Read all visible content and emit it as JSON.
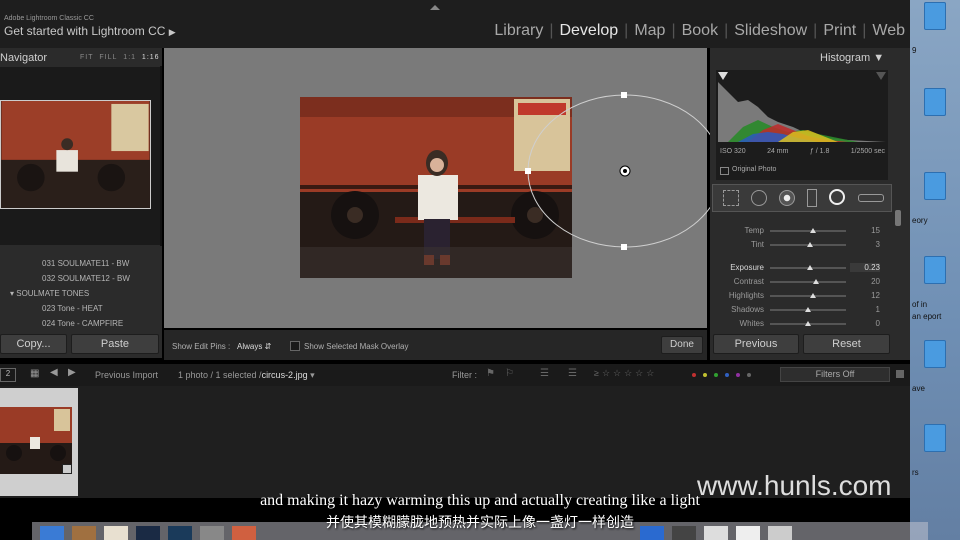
{
  "app": {
    "subtitle": "Adobe Lightroom Classic CC",
    "identity_plate": "Get started with Lightroom CC"
  },
  "modules": {
    "items": [
      "Library",
      "Develop",
      "Map",
      "Book",
      "Slideshow",
      "Print",
      "Web"
    ],
    "active": "Develop"
  },
  "navigator": {
    "title": "Navigator",
    "zoom": [
      "FIT",
      "FILL",
      "1:1",
      "1:16"
    ]
  },
  "presets": [
    {
      "label": "031 SOULMATE11 - BW",
      "type": "item"
    },
    {
      "label": "032 SOULMATE12 - BW",
      "type": "item"
    },
    {
      "label": "SOULMATE TONES",
      "type": "folder"
    },
    {
      "label": "023 Tone - HEAT",
      "type": "item"
    },
    {
      "label": "024 Tone - CAMPFIRE",
      "type": "item"
    }
  ],
  "left_buttons": {
    "copy": "Copy...",
    "paste": "Paste"
  },
  "toolbar": {
    "pins_label": "Show Edit Pins :",
    "pins_value": "Always",
    "mask_overlay": "Show Selected Mask Overlay",
    "done": "Done"
  },
  "histogram": {
    "title": "Histogram",
    "iso": "ISO 320",
    "focal": "24 mm",
    "aperture": "ƒ / 1.8",
    "shutter": "1/2500 sec",
    "original_photo": "Original Photo"
  },
  "sliders": [
    {
      "label": "Temp",
      "value": "15",
      "pos": 0.57
    },
    {
      "label": "Tint",
      "value": "3",
      "pos": 0.52
    },
    {
      "label": "Exposure",
      "value": "0.23",
      "pos": 0.53
    },
    {
      "label": "Contrast",
      "value": "20",
      "pos": 0.6
    },
    {
      "label": "Highlights",
      "value": "12",
      "pos": 0.56
    },
    {
      "label": "Shadows",
      "value": "1",
      "pos": 0.5
    },
    {
      "label": "Whites",
      "value": "0",
      "pos": 0.5
    }
  ],
  "right_buttons": {
    "previous": "Previous",
    "reset": "Reset"
  },
  "filmstrip": {
    "page": "2",
    "source": "Previous Import",
    "info_prefix": "1 photo / 1 selected /",
    "filename": "circus-2.jpg",
    "filter_label": "Filter :",
    "filters_off": "Filters Off"
  },
  "desktop_labels": [
    "9",
    "eory",
    "of in",
    "an eport",
    "ave",
    "rs"
  ],
  "subtitles": {
    "en": "and making it hazy warming this up and actually creating like a light",
    "cn": "并使其模糊朦胧地预热并实际上像一盏灯一样创造"
  },
  "watermark": "www.hunls.com",
  "colors": {
    "accent": "#e6e6e6",
    "panel": "#2b2b2b"
  }
}
